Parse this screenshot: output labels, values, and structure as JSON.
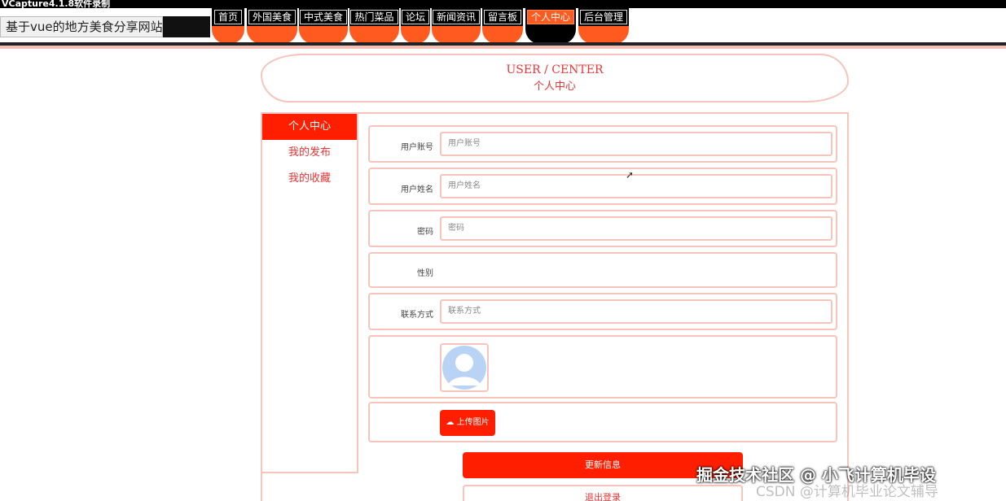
{
  "recorder_title": "VCapture4.1.8软件录制",
  "site": {
    "title": "基于vue的地方美食分享网站"
  },
  "nav": [
    {
      "label": "首页"
    },
    {
      "label": "外国美食"
    },
    {
      "label": "中式美食"
    },
    {
      "label": "热门菜品"
    },
    {
      "label": "论坛"
    },
    {
      "label": "新闻资讯"
    },
    {
      "label": "留言板"
    },
    {
      "label": "个人中心",
      "active": true
    },
    {
      "label": "后台管理"
    }
  ],
  "banner": {
    "en": "USER / CENTER",
    "cn": "个人中心"
  },
  "sidebar": [
    {
      "label": "个人中心",
      "active": true
    },
    {
      "label": "我的发布"
    },
    {
      "label": "我的收藏"
    }
  ],
  "form": {
    "account": {
      "label": "用户账号",
      "placeholder": "用户账号"
    },
    "name": {
      "label": "用户姓名",
      "placeholder": "用户姓名"
    },
    "password": {
      "label": "密码",
      "placeholder": "密码"
    },
    "gender": {
      "label": "性别"
    },
    "contact": {
      "label": "联系方式",
      "placeholder": "联系方式"
    },
    "upload_label": "上传图片",
    "update_label": "更新信息",
    "logout_label": "退出登录"
  },
  "watermark": {
    "line1": "掘金技术社区 @ 小飞计算机毕设",
    "line2": "CSDN @计算机毕业论文辅导"
  },
  "colors": {
    "accent": "#ff1e00",
    "border": "#f6c4bb",
    "text": "#e33333"
  }
}
